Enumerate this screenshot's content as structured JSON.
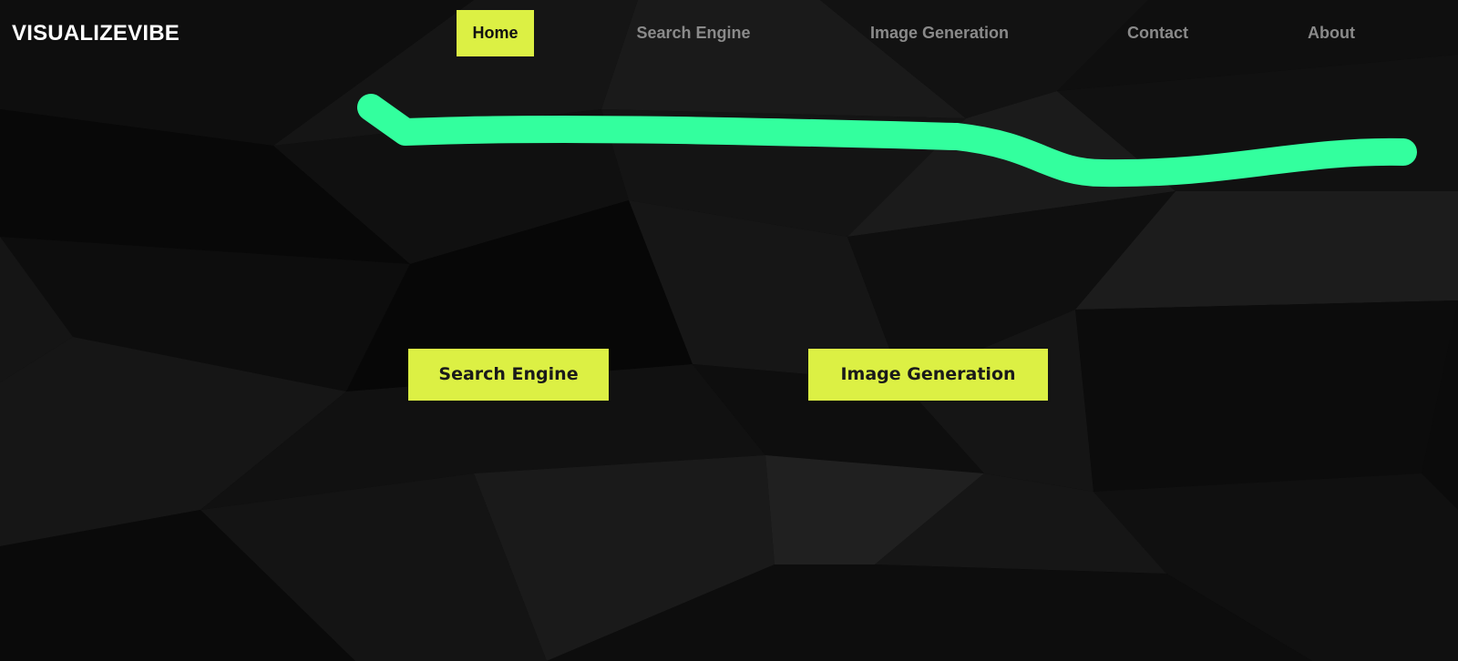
{
  "brand": {
    "name": "VISUALIZEVIBE"
  },
  "nav": {
    "items": [
      {
        "label": "Home",
        "active": true
      },
      {
        "label": "Search Engine",
        "active": false
      },
      {
        "label": "Image Generation",
        "active": false
      },
      {
        "label": "Contact",
        "active": false
      },
      {
        "label": "About",
        "active": false
      }
    ]
  },
  "hero": {
    "buttons": [
      {
        "label": "Search Engine"
      },
      {
        "label": "Image Generation"
      }
    ]
  },
  "colors": {
    "accent": "#dcf044",
    "stroke": "#33ff9e",
    "background": "#0c0c0c",
    "nav_text": "#8a8a8a",
    "brand_text": "#ffffff"
  }
}
